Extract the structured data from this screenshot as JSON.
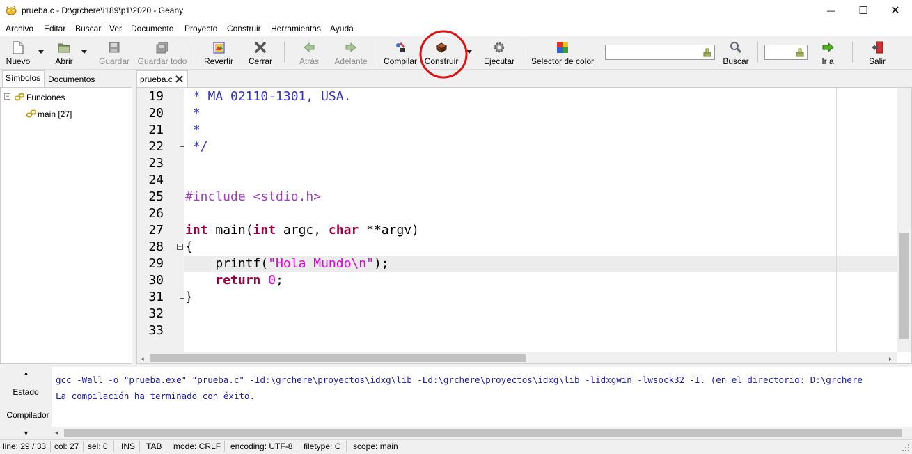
{
  "window": {
    "title": "prueba.c - D:\\grchere\\i189\\p1\\2020 - Geany",
    "minimize": "—",
    "maximize": "☐",
    "close": "✕"
  },
  "menu": [
    {
      "label": "Archivo"
    },
    {
      "label": "Editar"
    },
    {
      "label": "Buscar"
    },
    {
      "label": "Ver"
    },
    {
      "label": "Documento"
    },
    {
      "label": "Proyecto"
    },
    {
      "label": "Construir"
    },
    {
      "label": "Herramientas"
    },
    {
      "label": "Ayuda"
    }
  ],
  "toolbar": {
    "new": "Nuevo",
    "open": "Abrir",
    "save": "Guardar",
    "save_all": "Guardar todo",
    "revert": "Revertir",
    "close": "Cerrar",
    "back": "Atrás",
    "forward": "Adelante",
    "compile": "Compilar",
    "build": "Construir",
    "run": "Ejecutar",
    "color_picker": "Selector de color",
    "search": "Buscar",
    "search_value": "",
    "goto": "Ir a",
    "goto_value": "",
    "quit": "Salir"
  },
  "sidebar": {
    "tabs": [
      "Símbolos",
      "Documentos"
    ],
    "tree": {
      "group": "Funciones",
      "items": [
        "main [27]"
      ]
    }
  },
  "editor": {
    "tab": "prueba.c",
    "lines": [
      {
        "n": "19",
        "parts": [
          {
            "t": " * MA 02110-1301, USA.",
            "c": "cm"
          }
        ]
      },
      {
        "n": "20",
        "parts": [
          {
            "t": " *",
            "c": "cm"
          }
        ]
      },
      {
        "n": "21",
        "parts": [
          {
            "t": " *",
            "c": "cm"
          }
        ]
      },
      {
        "n": "22",
        "parts": [
          {
            "t": " */",
            "c": "cm"
          }
        ]
      },
      {
        "n": "23",
        "parts": []
      },
      {
        "n": "24",
        "parts": []
      },
      {
        "n": "25",
        "parts": [
          {
            "t": "#include <stdio.h>",
            "c": "pp"
          }
        ]
      },
      {
        "n": "26",
        "parts": []
      },
      {
        "n": "27",
        "parts": [
          {
            "t": "int",
            "c": "kw"
          },
          {
            "t": " main(",
            "c": ""
          },
          {
            "t": "int",
            "c": "kw"
          },
          {
            "t": " argc, ",
            "c": ""
          },
          {
            "t": "char",
            "c": "kw"
          },
          {
            "t": " **argv)",
            "c": ""
          }
        ]
      },
      {
        "n": "28",
        "parts": [
          {
            "t": "{",
            "c": ""
          }
        ]
      },
      {
        "n": "29",
        "parts": [
          {
            "t": "    printf(",
            "c": ""
          },
          {
            "t": "\"Hola Mundo\\n\"",
            "c": "st"
          },
          {
            "t": ");",
            "c": ""
          }
        ]
      },
      {
        "n": "30",
        "parts": [
          {
            "t": "    ",
            "c": ""
          },
          {
            "t": "return",
            "c": "kw"
          },
          {
            "t": " ",
            "c": ""
          },
          {
            "t": "0",
            "c": "nm"
          },
          {
            "t": ";",
            "c": ""
          }
        ]
      },
      {
        "n": "31",
        "parts": [
          {
            "t": "}",
            "c": ""
          }
        ]
      },
      {
        "n": "32",
        "parts": []
      },
      {
        "n": "33",
        "parts": []
      }
    ]
  },
  "messages": {
    "tabs": [
      "Estado",
      "Compilador"
    ],
    "lines": [
      "gcc -Wall -o \"prueba.exe\" \"prueba.c\" -Id:\\grchere\\proyectos\\idxg\\lib -Ld:\\grchere\\proyectos\\idxg\\lib -lidxgwin -lwsock32 -I. (en el directorio: D:\\grchere",
      "La compilación ha terminado con éxito."
    ]
  },
  "statusbar": {
    "line": "line: 29 / 33",
    "col": "col: 27",
    "sel": "sel: 0",
    "ins": "INS",
    "tab": "TAB",
    "mode": "mode: CRLF",
    "encoding": "encoding: UTF-8",
    "filetype": "filetype: C",
    "scope": "scope: main"
  },
  "colors": {
    "keyword": "#99003d",
    "comment": "#3333cc",
    "preprocessor": "#a040c0",
    "string": "#e000e0",
    "annotation_circle": "#e01010"
  }
}
